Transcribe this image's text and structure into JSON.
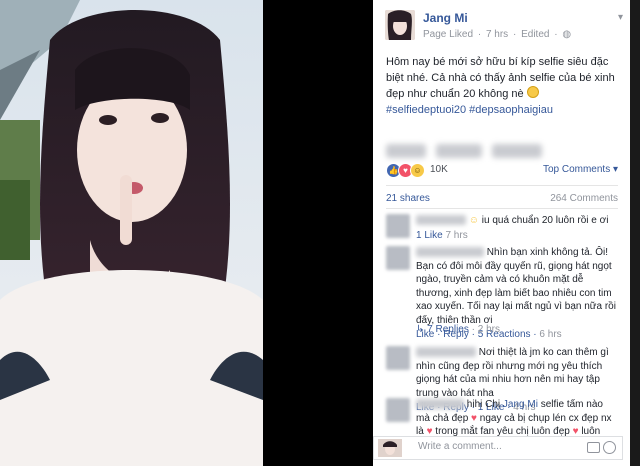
{
  "post": {
    "author": "Jang Mi",
    "page_liked": "Page Liked",
    "time": "7 hrs",
    "edited": "Edited",
    "separator": "·",
    "text_line1": "Hôm nay bé mới sở hữu bí kíp selfie siêu đặc biệt nhé. Cả nhà có thấy ảnh selfie của bé xinh đẹp như chuẩn 20 không nè",
    "hashtags": "#selfiedeptuoi20 #depsaophaigiau"
  },
  "reactions": {
    "count": "10K",
    "top_comments": "Top Comments ▾",
    "shares": "21 shares",
    "comments": "264 Comments"
  },
  "comments": [
    {
      "text": "iu quá chuẩn 20 luôn rồi e ơi",
      "like": "1 Like",
      "time": "7 hrs"
    },
    {
      "text": "Nhìn bạn xinh không tả. Ôi! Bạn có đôi môi đầy quyến rũ, giọng hát ngọt ngào, truyền cảm và có khuôn mặt dễ thương, xinh đẹp làm biết bao nhiêu con tim xao xuyến. Tối nay lại mất ngủ vì bạn nữa rồi đấy, thiên thần ơi",
      "like": "Like",
      "reply": "Reply",
      "reactions": "5 Reactions",
      "time": "6 hrs"
    },
    {
      "text": "Nơi thiệt là jm ko can thêm gì nhìn cũng đẹp rồi nhưng mới ng yêu thích giọng hát của mi nhiu hơn nên mi hay tập trung vào hát nha",
      "like": "Like",
      "reply": "Reply",
      "likes": "1 Like",
      "time": "4 hrs"
    },
    {
      "prefix": "hihi Chị",
      "mention": "Jang Mi",
      "text": "selfie tấm nào mà chả đẹp",
      "text2": "ngay cả bị chụp lén cx đẹp nx là",
      "text3": "trong mắt fan yêu chị luôn đẹp",
      "text4": "luôn ủng hộ chị"
    }
  ],
  "replies": {
    "label": "7 Replies",
    "time": "2 hrs"
  },
  "composer": {
    "placeholder": "Write a comment..."
  },
  "icons": {
    "header": "chevron-down-icon",
    "like": "like-reaction-icon",
    "love": "love-reaction-icon",
    "haha": "haha-reaction-icon",
    "reply_arrow": "reply-arrow-icon",
    "camera": "camera-icon",
    "emoji": "emoji-icon"
  }
}
